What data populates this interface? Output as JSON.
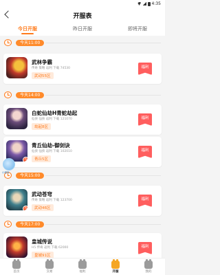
{
  "status_bar": {
    "left": "",
    "time": "4:35"
  },
  "header": {
    "title": "开服表"
  },
  "tabs": [
    {
      "label": "今日开服",
      "active": true
    },
    {
      "label": "昨日开服",
      "active": false
    },
    {
      "label": "即将开服",
      "active": false
    }
  ],
  "sections": [
    {
      "time": "今天11:00",
      "games": [
        {
          "name": "武林争霸",
          "meta": "传奇 策略 返利 下载 74530",
          "server": "武动55区",
          "welfare": "福利"
        }
      ]
    },
    {
      "time": "今天14:00",
      "games": [
        {
          "name": "白蛇仙劫H青蛇劫起",
          "meta": "仙侠 仙侠 返利 下载 121070",
          "server": "劫起8区",
          "welfare": "福利"
        },
        {
          "name": "青丘仙劫-御剑诀",
          "meta": "仙侠 仙侠 返利 下载 102010",
          "server": "青丘5区",
          "welfare": "福利"
        }
      ]
    },
    {
      "time": "今天15:00",
      "games": [
        {
          "name": "武动苍穹",
          "meta": "传奇 策略 返利 下载 123700",
          "server": "武动46区",
          "welfare": "福利"
        }
      ]
    },
    {
      "time": "今天17:00",
      "games": [
        {
          "name": "皇城传说",
          "meta": "H5 传奇 返利 下载 62000",
          "server": "皇城91区",
          "welfare": "福利"
        }
      ]
    }
  ],
  "float_widget": {
    "label": "小程序"
  },
  "bottom_nav": [
    {
      "label": "首页",
      "active": false
    },
    {
      "label": "交易",
      "active": false
    },
    {
      "label": "福利",
      "active": false
    },
    {
      "label": "开服",
      "active": true
    },
    {
      "label": "我的",
      "active": false
    }
  ],
  "colors": {
    "accent": "#ff7a1a",
    "welfare": "#ff5e5e",
    "nav_active": "#f5a623"
  }
}
